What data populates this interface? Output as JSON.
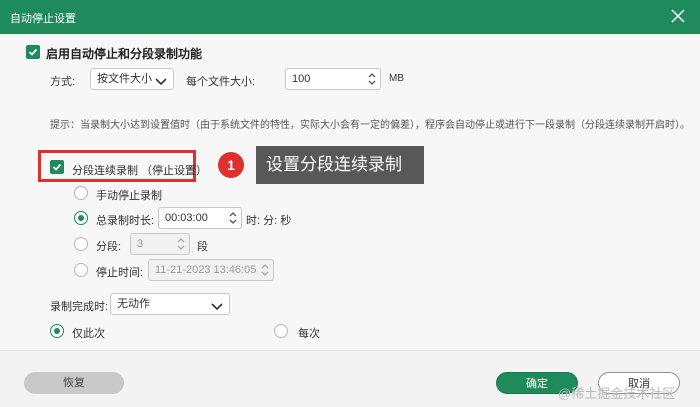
{
  "window": {
    "title": "自动停止设置"
  },
  "main": {
    "enable_label": "启用自动停止和分段录制功能",
    "method_label": "方式:",
    "method_value": "按文件大小",
    "size_label": "每个文件大小:",
    "size_value": "100",
    "size_unit": "MB",
    "hint": "提示：当录制大小达到设置值时（由于系统文件的特性，实际大小会有一定的偏差），程序会自动停止或进行下一段录制（分段连续录制开启时）。",
    "segment_label": "分段连续录制 （停止设置）",
    "manual_stop": "手动停止录制",
    "total_duration_label": "总录制时长:",
    "total_duration_value": "00:03:00",
    "duration_unit": "时: 分: 秒",
    "segments_label": "分段:",
    "segments_value": "3",
    "segments_unit": "段",
    "stop_time_label": "停止时间:",
    "stop_time_value": "11-21-2023 13:46:05",
    "after_label": "录制完成时:",
    "after_value": "无动作",
    "only_once": "仅此次",
    "every_time": "每次"
  },
  "annotation": {
    "badge": "1",
    "callout": "设置分段连续录制",
    "color": "#e0302d"
  },
  "footer": {
    "restore": "恢复",
    "ok": "确定",
    "cancel": "取消"
  },
  "watermark": "@稀土掘金技术社区",
  "colors": {
    "accent": "#1f8a5b"
  }
}
